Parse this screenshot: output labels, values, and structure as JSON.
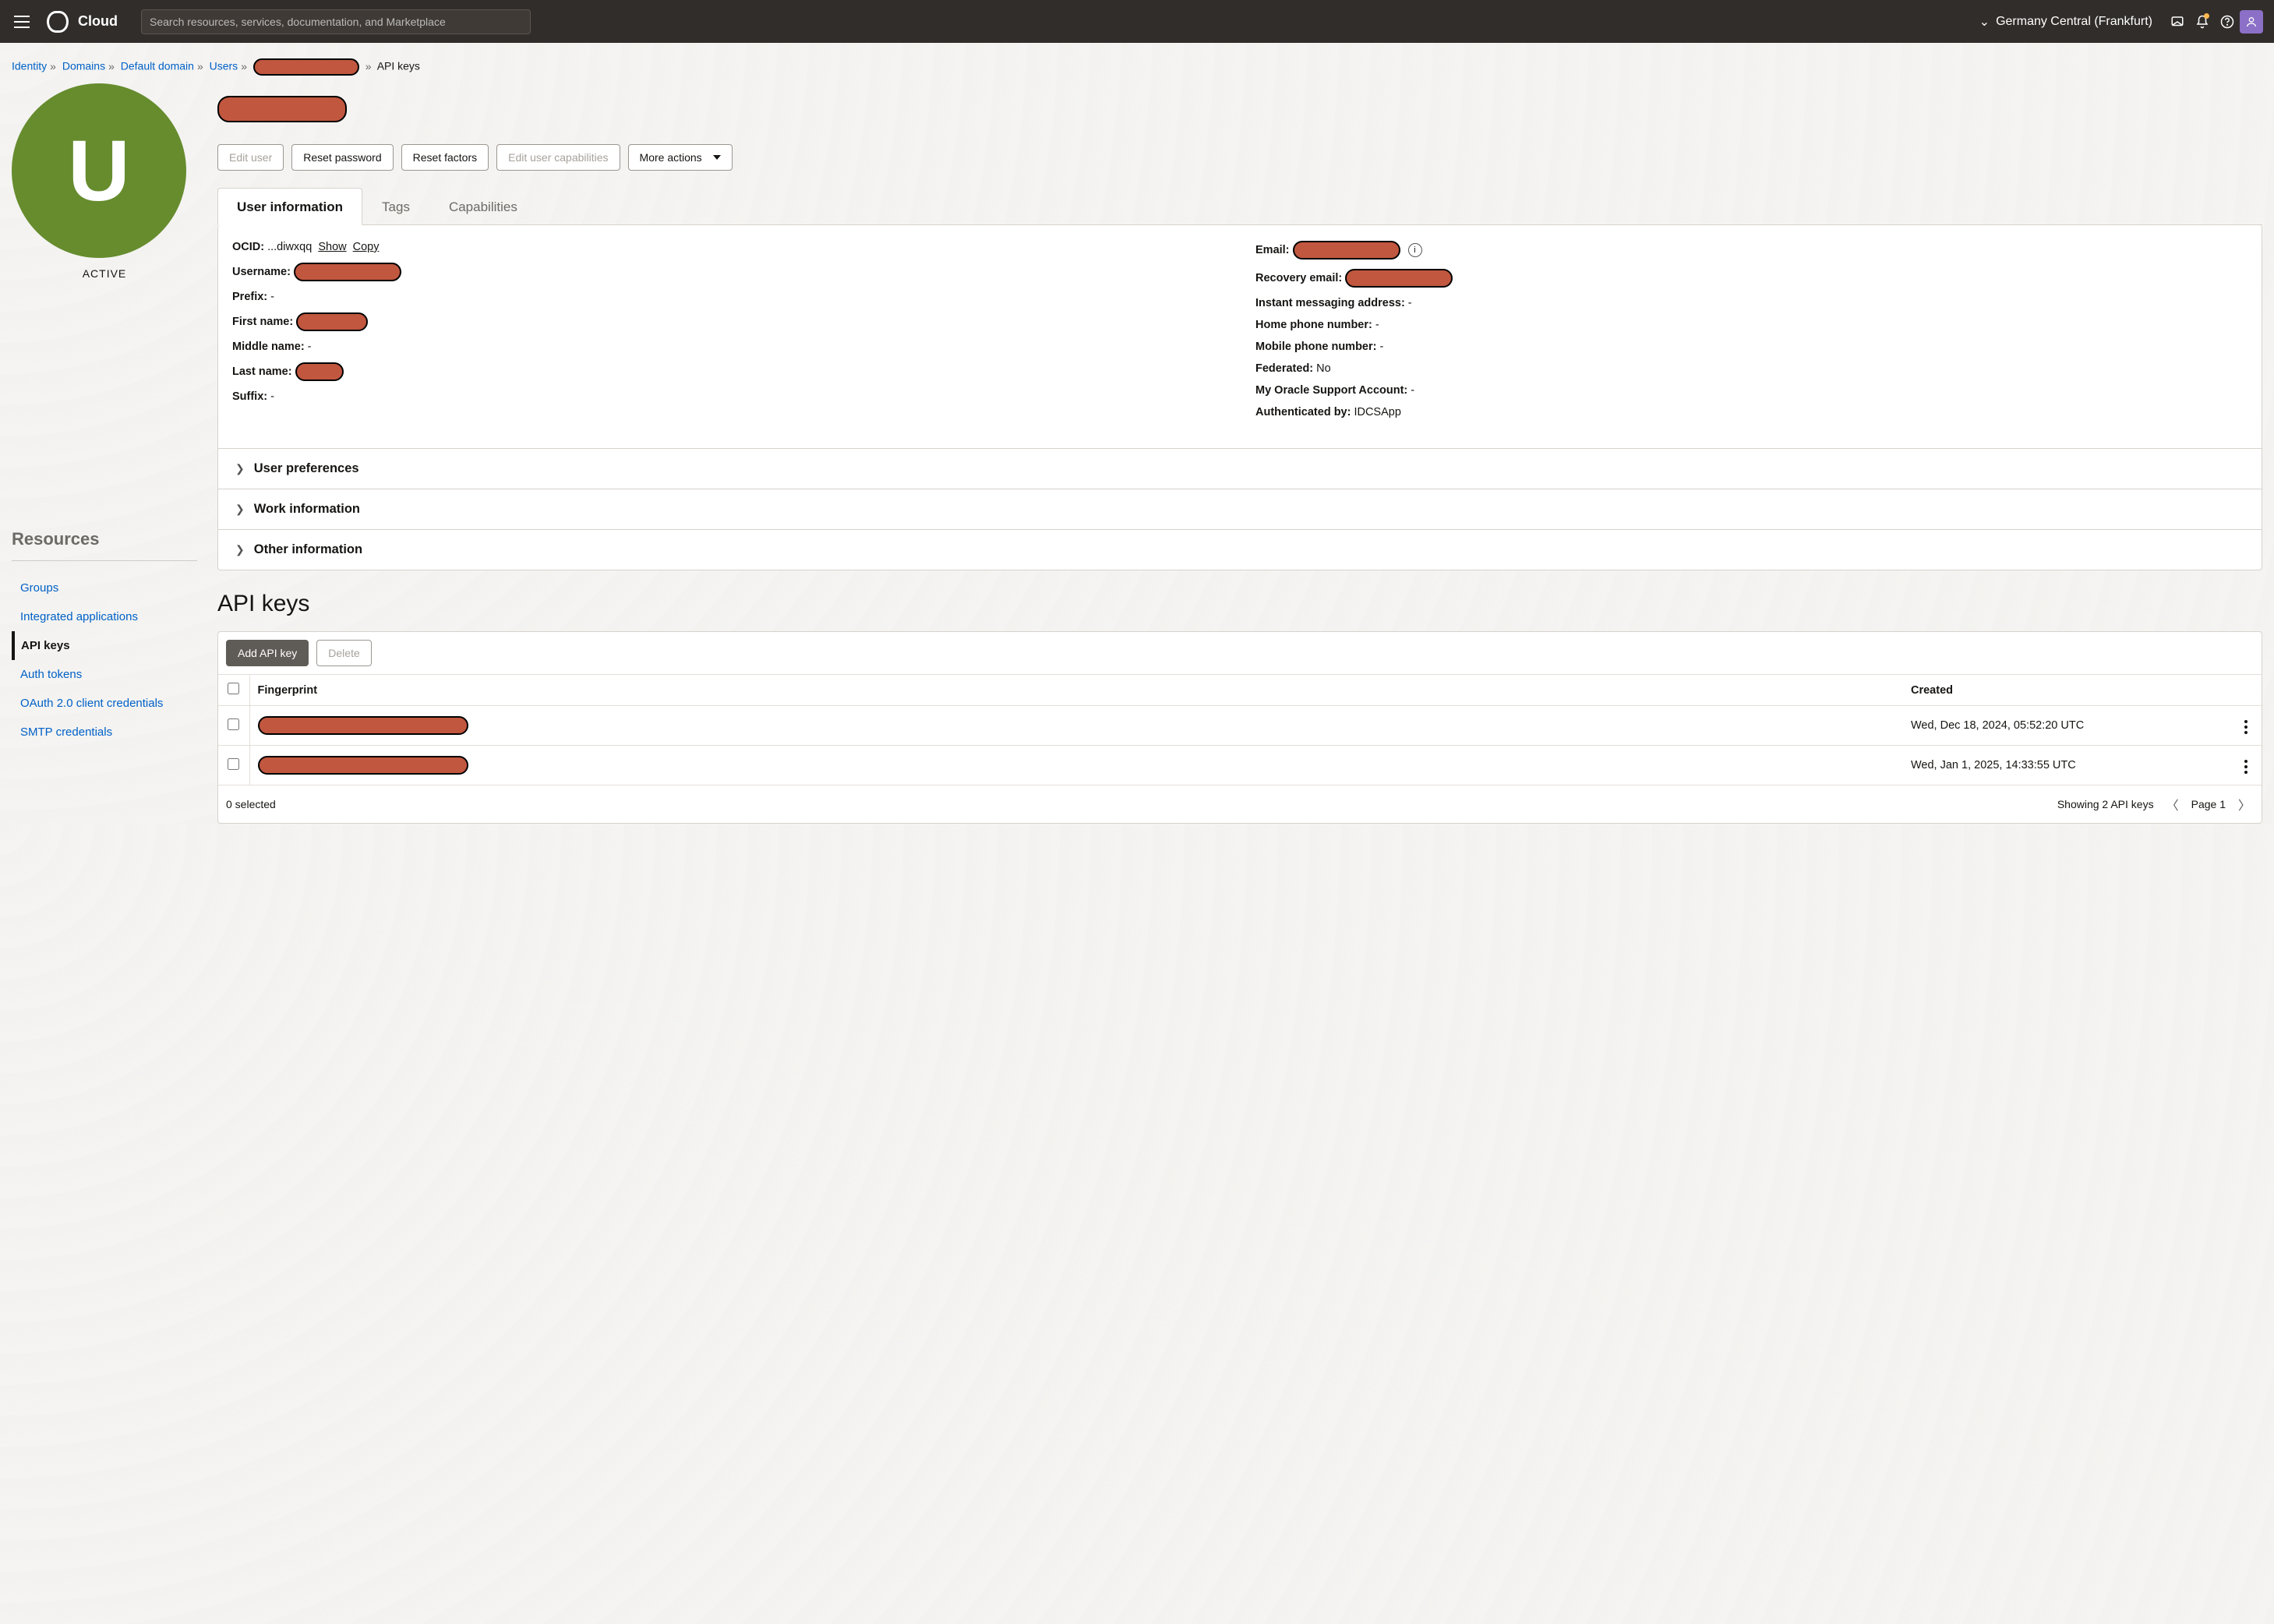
{
  "nav": {
    "brand": "Cloud",
    "search_placeholder": "Search resources, services, documentation, and Marketplace",
    "region": "Germany Central (Frankfurt)"
  },
  "breadcrumb": {
    "items": [
      "Identity",
      "Domains",
      "Default domain",
      "Users"
    ],
    "current": "API keys"
  },
  "user": {
    "avatar_letter": "U",
    "status": "ACTIVE"
  },
  "actions": {
    "edit_user": "Edit user",
    "reset_password": "Reset password",
    "reset_factors": "Reset factors",
    "edit_capabilities": "Edit user capabilities",
    "more": "More actions"
  },
  "tabs": {
    "user_info": "User information",
    "tags": "Tags",
    "capabilities": "Capabilities"
  },
  "info_left": {
    "ocid_label": "OCID:",
    "ocid_value": "...diwxqq",
    "show": "Show",
    "copy": "Copy",
    "username_label": "Username:",
    "prefix_label": "Prefix:",
    "prefix_value": "-",
    "first_name_label": "First name:",
    "middle_name_label": "Middle name:",
    "middle_name_value": "-",
    "last_name_label": "Last name:",
    "suffix_label": "Suffix:",
    "suffix_value": "-"
  },
  "info_right": {
    "email_label": "Email:",
    "recovery_label": "Recovery email:",
    "im_label": "Instant messaging address:",
    "im_value": "-",
    "home_label": "Home phone number:",
    "home_value": "-",
    "mobile_label": "Mobile phone number:",
    "mobile_value": "-",
    "federated_label": "Federated:",
    "federated_value": "No",
    "mos_label": "My Oracle Support Account:",
    "mos_value": "-",
    "auth_label": "Authenticated by:",
    "auth_value": "IDCSApp"
  },
  "accordions": {
    "prefs": "User preferences",
    "work": "Work information",
    "other": "Other information"
  },
  "resources": {
    "heading": "Resources",
    "links": {
      "groups": "Groups",
      "integrated": "Integrated applications",
      "api_keys": "API keys",
      "auth_tokens": "Auth tokens",
      "oauth": "OAuth 2.0 client credentials",
      "smtp": "SMTP credentials"
    }
  },
  "api_keys": {
    "heading": "API keys",
    "add": "Add API key",
    "delete": "Delete",
    "col_fingerprint": "Fingerprint",
    "col_created": "Created",
    "rows": [
      {
        "created": "Wed, Dec 18, 2024, 05:52:20 UTC"
      },
      {
        "created": "Wed, Jan 1, 2025, 14:33:55 UTC"
      }
    ],
    "selected": "0 selected",
    "showing": "Showing 2 API keys",
    "page": "Page 1"
  }
}
